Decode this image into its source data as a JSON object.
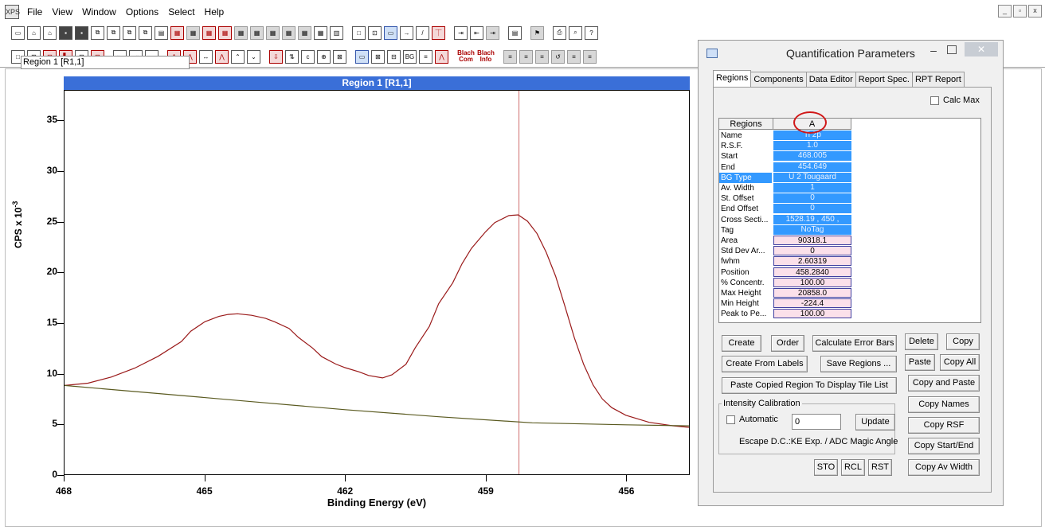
{
  "menubar": {
    "app_icon": "XPS",
    "items": [
      "File",
      "View",
      "Window",
      "Options",
      "Select",
      "Help"
    ],
    "win_controls": [
      "_",
      "▫",
      "x"
    ]
  },
  "toolbar2_labels": {
    "blach_com": "Blach Com",
    "blach_info": "Blach Info",
    "bg": "BG"
  },
  "plot": {
    "title": "Region 1 [R1,1]",
    "xlabel": "Binding Energy (eV)",
    "ylabel": "CPS x 10",
    "ylabel_exp": "-3",
    "colors": {
      "spectrum": "#9a1a1a",
      "background": "#5a5a20",
      "marker": "#d07070",
      "title_bar": "#3a6fd8"
    }
  },
  "chart_data": {
    "type": "line",
    "title": "Region 1 [R1,1]",
    "xlabel": "Binding Energy (eV)",
    "ylabel": "CPS x 10-3",
    "xlim": [
      468,
      454.649
    ],
    "ylim": [
      0,
      38
    ],
    "x_ticks": [
      "468",
      "465",
      "462",
      "459",
      "456"
    ],
    "y_ticks": [
      "0",
      "5",
      "10",
      "15",
      "20",
      "25",
      "30",
      "35"
    ],
    "marker_x": 458.284,
    "series": [
      {
        "x": [
          468,
          467.5,
          467,
          466.5,
          466,
          465.5,
          465.3,
          465,
          464.7,
          464.5,
          464.3,
          464,
          463.7,
          463.5,
          463.2,
          463,
          462.7,
          462.5,
          462.2,
          462,
          461.7,
          461.5,
          461.2,
          461,
          460.7,
          460.5,
          460.2,
          460,
          459.7,
          459.5,
          459.3,
          459,
          458.8,
          458.5,
          458.3,
          458.1,
          457.9,
          457.7,
          457.5,
          457.3,
          457.1,
          456.9,
          456.7,
          456.5,
          456.3,
          456,
          455.5,
          455,
          454.649
        ],
        "values": [
          8.8,
          8.9,
          9.5,
          10.5,
          11.8,
          13.3,
          14.2,
          15.0,
          15.5,
          15.8,
          16.0,
          15.9,
          15.5,
          15.0,
          14.3,
          13.5,
          12.6,
          11.8,
          11.0,
          10.5,
          10.0,
          9.7,
          9.6,
          10.0,
          11.0,
          12.5,
          14.5,
          16.8,
          19.0,
          21.0,
          22.5,
          24.0,
          24.8,
          25.5,
          25.7,
          25.2,
          24.0,
          22.0,
          19.5,
          16.5,
          13.5,
          11.0,
          9.0,
          7.5,
          6.5,
          5.7,
          5.1,
          4.9,
          4.8
        ]
      },
      {
        "x": [
          468,
          466,
          464,
          462,
          460,
          458,
          456,
          454.649
        ],
        "values": [
          8.8,
          8.0,
          7.2,
          6.4,
          5.7,
          5.1,
          4.9,
          4.8
        ]
      }
    ]
  },
  "dialog": {
    "title": "Quantification Parameters",
    "min_label": "–",
    "close_label": "✕",
    "tabs": [
      "Regions",
      "Components",
      "Data Editor",
      "Report Spec.",
      "RPT Report"
    ],
    "region_field": "Region 1 [R1,1]",
    "calc_max": "Calc Max",
    "grid": {
      "col_headers": [
        "Regions",
        "A"
      ],
      "rows": [
        {
          "name": "Name",
          "value": "Ti 2p",
          "style": "blue"
        },
        {
          "name": "R.S.F.",
          "value": "1.0",
          "style": "blue"
        },
        {
          "name": "Start",
          "value": "468.005",
          "style": "blue"
        },
        {
          "name": "End",
          "value": "454.649",
          "style": "blue"
        },
        {
          "name": "BG Type",
          "value": "U 2 Tougaard",
          "style": "blue",
          "selected": true
        },
        {
          "name": "Av. Width",
          "value": "1",
          "style": "blue"
        },
        {
          "name": "St. Offset",
          "value": "0",
          "style": "blue"
        },
        {
          "name": "End Offset",
          "value": "0",
          "style": "blue"
        },
        {
          "name": "Cross Secti...",
          "value": "1528.19 , 450 ,",
          "style": "blue"
        },
        {
          "name": "Tag",
          "value": "NoTag",
          "style": "blue"
        },
        {
          "name": "Area",
          "value": "90318.1",
          "style": "pink"
        },
        {
          "name": "Std Dev Ar...",
          "value": "0",
          "style": "pink"
        },
        {
          "name": "fwhm",
          "value": "2.60319",
          "style": "pink"
        },
        {
          "name": "Position",
          "value": "458.2840",
          "style": "pink"
        },
        {
          "name": "% Concentr.",
          "value": "100.00",
          "style": "pink"
        },
        {
          "name": "Max Height",
          "value": "20858.0",
          "style": "pink"
        },
        {
          "name": "Min Height",
          "value": "-224.4",
          "style": "pink"
        },
        {
          "name": "Peak to Pe...",
          "value": "100.00",
          "style": "pink"
        }
      ]
    },
    "buttons": {
      "create": "Create",
      "order": "Order",
      "calc_error": "Calculate Error Bars",
      "delete": "Delete",
      "copy": "Copy",
      "create_from_labels": "Create From Labels",
      "save_regions": "Save Regions ...",
      "paste": "Paste",
      "copy_all": "Copy All",
      "paste_copied": "Paste Copied Region To Display Tile List",
      "copy_and_paste": "Copy and Paste",
      "copy_names": "Copy Names",
      "update": "Update",
      "copy_rsf": "Copy RSF",
      "copy_start_end": "Copy Start/End",
      "sto": "STO",
      "rcl": "RCL",
      "rst": "RST",
      "copy_av_width": "Copy Av Width"
    },
    "intensity": {
      "group_label": "Intensity Calibration",
      "automatic": "Automatic",
      "value": "0",
      "escape": "Escape D.C.:KE Exp. / ADC Magic Angle"
    }
  }
}
